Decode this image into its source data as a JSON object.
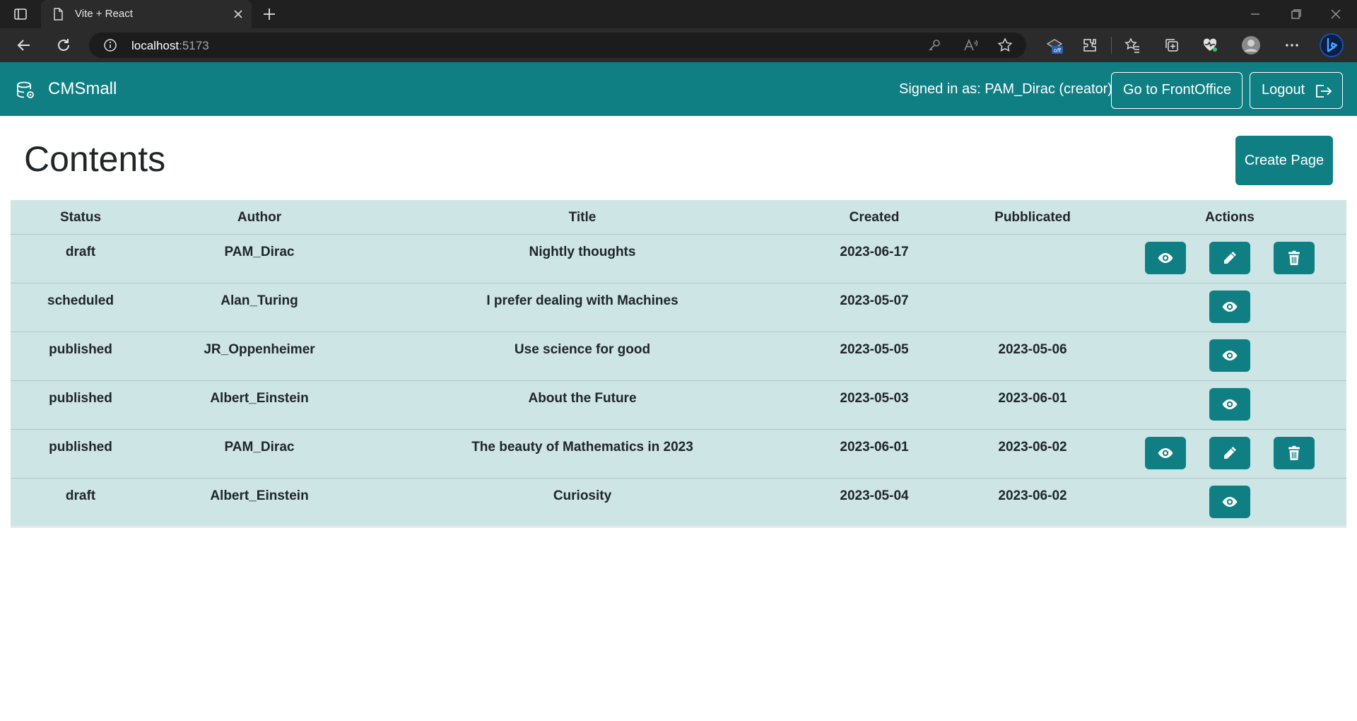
{
  "browser": {
    "tab_title": "Vite + React",
    "url_host": "localhost",
    "url_port": ":5173"
  },
  "navbar": {
    "brand": "CMSmall",
    "signed_in": "Signed in as: PAM_Dirac (creator)",
    "frontoffice_label": "Go to FrontOffice",
    "logout_label": "Logout"
  },
  "page": {
    "title": "Contents",
    "create_label": "Create Page"
  },
  "table": {
    "headers": [
      "Status",
      "Author",
      "Title",
      "Created",
      "Pubblicated",
      "Actions"
    ],
    "rows": [
      {
        "status": "draft",
        "author": "PAM_Dirac",
        "title": "Nightly thoughts",
        "created": "2023-06-17",
        "published": "",
        "actions": [
          "view",
          "edit",
          "delete"
        ]
      },
      {
        "status": "scheduled",
        "author": "Alan_Turing",
        "title": "I prefer dealing with Machines",
        "created": "2023-05-07",
        "published": "",
        "actions": [
          "view"
        ]
      },
      {
        "status": "published",
        "author": "JR_Oppenheimer",
        "title": "Use science for good",
        "created": "2023-05-05",
        "published": "2023-05-06",
        "actions": [
          "view"
        ]
      },
      {
        "status": "published",
        "author": "Albert_Einstein",
        "title": "About the Future",
        "created": "2023-05-03",
        "published": "2023-06-01",
        "actions": [
          "view"
        ]
      },
      {
        "status": "published",
        "author": "PAM_Dirac",
        "title": "The beauty of Mathematics in 2023",
        "created": "2023-06-01",
        "published": "2023-06-02",
        "actions": [
          "view",
          "edit",
          "delete"
        ]
      },
      {
        "status": "draft",
        "author": "Albert_Einstein",
        "title": "Curiosity",
        "created": "2023-05-04",
        "published": "2023-06-02",
        "actions": [
          "view"
        ]
      }
    ]
  },
  "colors": {
    "brand": "#0f7f83",
    "table_bg": "#cde5e5"
  }
}
